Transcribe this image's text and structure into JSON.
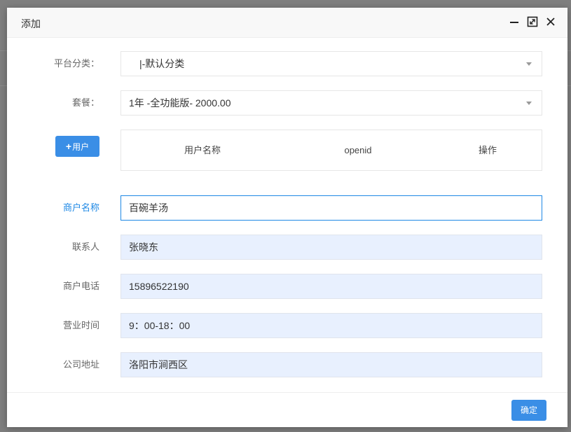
{
  "dialog": {
    "title": "添加",
    "icons": [
      "minimize-icon",
      "maximize-icon",
      "close-icon"
    ]
  },
  "form": {
    "platform_category": {
      "label": "平台分类：",
      "value": "|-默认分类"
    },
    "package": {
      "label": "套餐：",
      "value": "1年 -全功能版- 2000.00"
    },
    "add_user_button": {
      "icon": "plus-icon",
      "label": "用户"
    },
    "user_table": {
      "columns": [
        "用户名称",
        "openid",
        "操作"
      ]
    },
    "merchant_name": {
      "label": "商户名称",
      "value": "百碗羊汤"
    },
    "contact": {
      "label": "联系人",
      "value": "张晓东"
    },
    "merchant_phone": {
      "label": "商户电话",
      "value": "15896522190"
    },
    "business_hours": {
      "label": "营业时间",
      "value": "9：00-18：00"
    },
    "company_address": {
      "label": "公司地址",
      "value": "洛阳市涧西区"
    }
  },
  "footer": {
    "confirm_label": "确定"
  },
  "colors": {
    "accent": "#3a8ee6",
    "focus_border": "#1e88e5",
    "autofill_bg": "#e8f0fe"
  }
}
